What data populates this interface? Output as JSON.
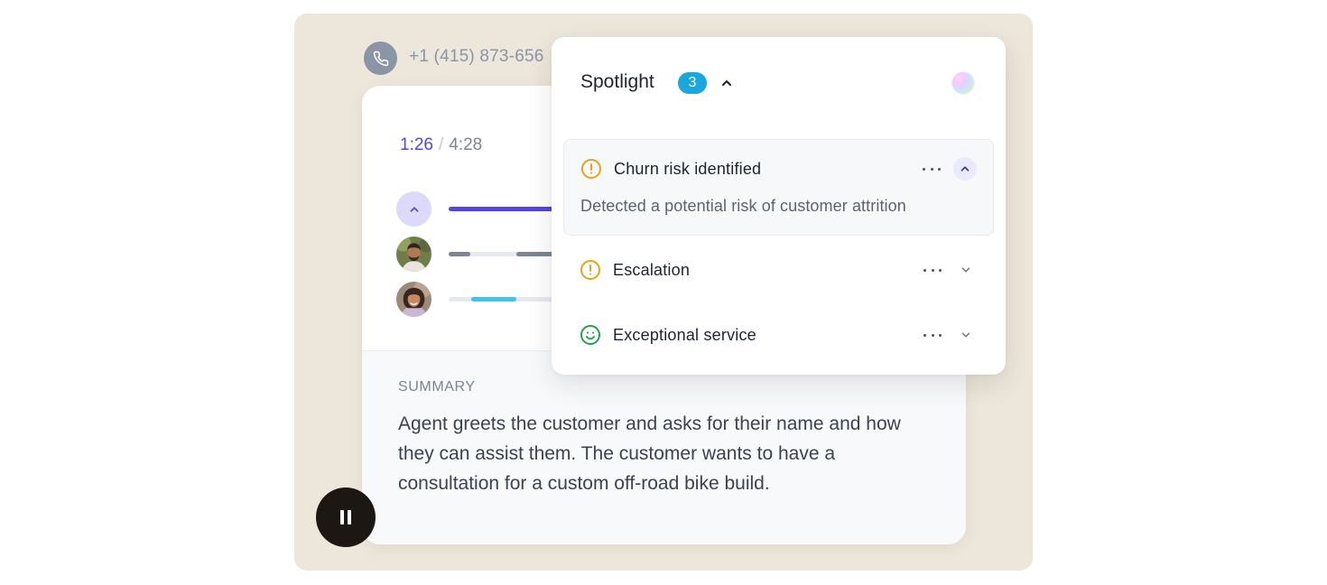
{
  "call": {
    "phone_number": "+1 (415) 873-656",
    "current_time": "1:26",
    "separator": "/",
    "total_time": "4:28"
  },
  "summary": {
    "label": "SUMMARY",
    "text": "Agent greets the customer and asks for their name and how they can assist them. The customer wants to have a consultation for a custom off-road bike build."
  },
  "spotlight": {
    "title": "Spotlight",
    "count": "3",
    "items": [
      {
        "title": "Churn risk identified",
        "description": "Detected a potential risk of customer attrition",
        "icon": "alert-circle-icon",
        "expanded": true
      },
      {
        "title": "Escalation",
        "icon": "alert-circle-icon",
        "expanded": false
      },
      {
        "title": "Exceptional service",
        "icon": "smile-icon",
        "expanded": false
      }
    ]
  },
  "colors": {
    "accent": "#4f46e5",
    "badge": "#1aa7e0",
    "warning": "#e8a317",
    "success": "#22a447",
    "background": "#ede6da"
  }
}
